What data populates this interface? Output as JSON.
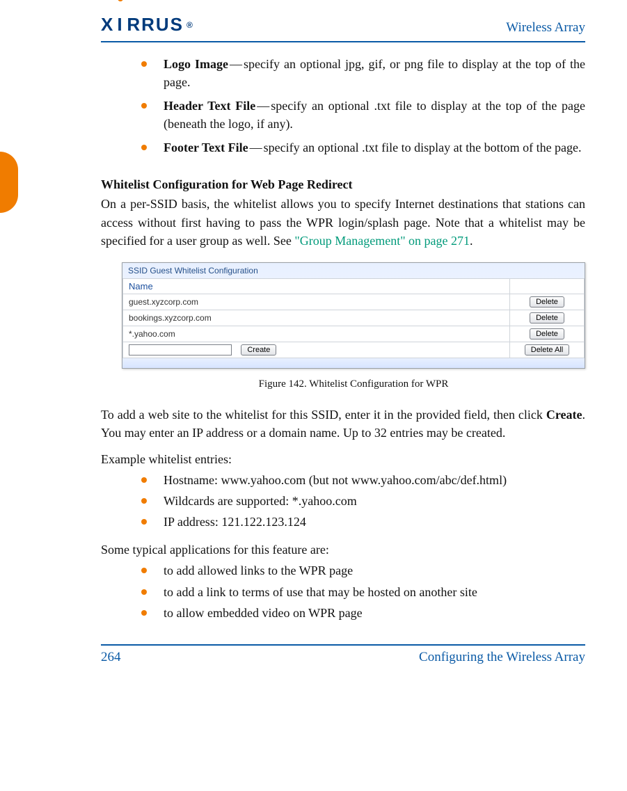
{
  "header": {
    "logo_text": "XIRRUS",
    "logo_reg": "®",
    "doc_title": "Wireless Array"
  },
  "bullets_top": [
    {
      "title": "Logo Image",
      "sep": "—",
      "desc": "specify an optional jpg, gif, or png file to display at the top of the page."
    },
    {
      "title": "Header Text File",
      "sep": "—",
      "desc": "specify an optional .txt file to display at the top of the page (beneath the logo, if any)."
    },
    {
      "title": "Footer Text File",
      "sep": "—",
      "desc": "specify an optional .txt file to display at the bottom of the page."
    }
  ],
  "section": {
    "heading": "Whitelist Configuration for Web Page Redirect",
    "para1a": "On a per-SSID basis, the whitelist allows you to specify Internet destinations that stations can access without first having to pass the WPR login/splash page. Note that a whitelist may be specified for a user group as well. See ",
    "para1_link": "\"Group Management\" on page 271",
    "para1b": "."
  },
  "figure": {
    "caption": "Figure 142. Whitelist Configuration for WPR",
    "title": "SSID Guest   Whitelist Configuration",
    "col_name": "Name",
    "rows": [
      "guest.xyzcorp.com",
      "bookings.xyzcorp.com",
      "*.yahoo.com"
    ],
    "btn_delete": "Delete",
    "btn_create": "Create",
    "btn_delete_all": "Delete All",
    "input_value": ""
  },
  "after_fig": {
    "p1a": "To add a web site to the whitelist for this SSID, enter it in the provided field, then click ",
    "p1_b": "Create",
    "p1b": ". You may enter an IP address or a domain name. Up to 32 entries may be created.",
    "p2": "Example whitelist entries:"
  },
  "examples": [
    "Hostname: www.yahoo.com (but not www.yahoo.com/abc/def.html)",
    "Wildcards are supported: *.yahoo.com",
    "IP address: 121.122.123.124"
  ],
  "apps_intro": "Some typical applications for this feature are:",
  "apps": [
    "to add allowed links to the WPR page",
    "to add a link to terms of use that may be hosted on another site",
    "to allow embedded video on WPR page"
  ],
  "footer": {
    "page": "264",
    "section": "Configuring the Wireless Array"
  }
}
